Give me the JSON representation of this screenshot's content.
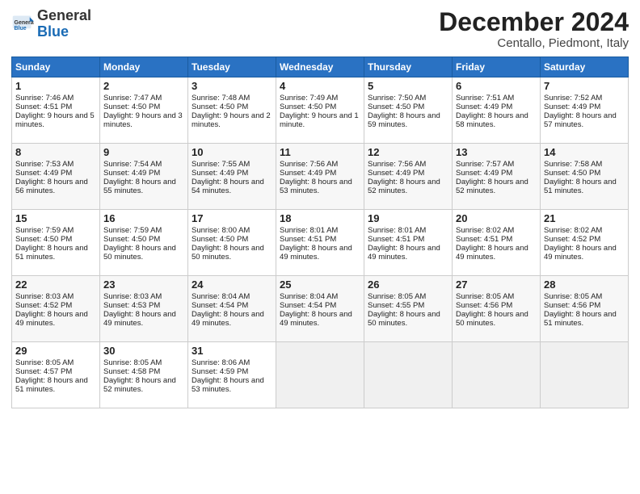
{
  "header": {
    "logo_general": "General",
    "logo_blue": "Blue",
    "month_title": "December 2024",
    "location": "Centallo, Piedmont, Italy"
  },
  "days_of_week": [
    "Sunday",
    "Monday",
    "Tuesday",
    "Wednesday",
    "Thursday",
    "Friday",
    "Saturday"
  ],
  "weeks": [
    [
      {
        "day": 1,
        "sunrise": "Sunrise: 7:46 AM",
        "sunset": "Sunset: 4:51 PM",
        "daylight": "Daylight: 9 hours and 5 minutes."
      },
      {
        "day": 2,
        "sunrise": "Sunrise: 7:47 AM",
        "sunset": "Sunset: 4:50 PM",
        "daylight": "Daylight: 9 hours and 3 minutes."
      },
      {
        "day": 3,
        "sunrise": "Sunrise: 7:48 AM",
        "sunset": "Sunset: 4:50 PM",
        "daylight": "Daylight: 9 hours and 2 minutes."
      },
      {
        "day": 4,
        "sunrise": "Sunrise: 7:49 AM",
        "sunset": "Sunset: 4:50 PM",
        "daylight": "Daylight: 9 hours and 1 minute."
      },
      {
        "day": 5,
        "sunrise": "Sunrise: 7:50 AM",
        "sunset": "Sunset: 4:50 PM",
        "daylight": "Daylight: 8 hours and 59 minutes."
      },
      {
        "day": 6,
        "sunrise": "Sunrise: 7:51 AM",
        "sunset": "Sunset: 4:49 PM",
        "daylight": "Daylight: 8 hours and 58 minutes."
      },
      {
        "day": 7,
        "sunrise": "Sunrise: 7:52 AM",
        "sunset": "Sunset: 4:49 PM",
        "daylight": "Daylight: 8 hours and 57 minutes."
      }
    ],
    [
      {
        "day": 8,
        "sunrise": "Sunrise: 7:53 AM",
        "sunset": "Sunset: 4:49 PM",
        "daylight": "Daylight: 8 hours and 56 minutes."
      },
      {
        "day": 9,
        "sunrise": "Sunrise: 7:54 AM",
        "sunset": "Sunset: 4:49 PM",
        "daylight": "Daylight: 8 hours and 55 minutes."
      },
      {
        "day": 10,
        "sunrise": "Sunrise: 7:55 AM",
        "sunset": "Sunset: 4:49 PM",
        "daylight": "Daylight: 8 hours and 54 minutes."
      },
      {
        "day": 11,
        "sunrise": "Sunrise: 7:56 AM",
        "sunset": "Sunset: 4:49 PM",
        "daylight": "Daylight: 8 hours and 53 minutes."
      },
      {
        "day": 12,
        "sunrise": "Sunrise: 7:56 AM",
        "sunset": "Sunset: 4:49 PM",
        "daylight": "Daylight: 8 hours and 52 minutes."
      },
      {
        "day": 13,
        "sunrise": "Sunrise: 7:57 AM",
        "sunset": "Sunset: 4:49 PM",
        "daylight": "Daylight: 8 hours and 52 minutes."
      },
      {
        "day": 14,
        "sunrise": "Sunrise: 7:58 AM",
        "sunset": "Sunset: 4:50 PM",
        "daylight": "Daylight: 8 hours and 51 minutes."
      }
    ],
    [
      {
        "day": 15,
        "sunrise": "Sunrise: 7:59 AM",
        "sunset": "Sunset: 4:50 PM",
        "daylight": "Daylight: 8 hours and 51 minutes."
      },
      {
        "day": 16,
        "sunrise": "Sunrise: 7:59 AM",
        "sunset": "Sunset: 4:50 PM",
        "daylight": "Daylight: 8 hours and 50 minutes."
      },
      {
        "day": 17,
        "sunrise": "Sunrise: 8:00 AM",
        "sunset": "Sunset: 4:50 PM",
        "daylight": "Daylight: 8 hours and 50 minutes."
      },
      {
        "day": 18,
        "sunrise": "Sunrise: 8:01 AM",
        "sunset": "Sunset: 4:51 PM",
        "daylight": "Daylight: 8 hours and 49 minutes."
      },
      {
        "day": 19,
        "sunrise": "Sunrise: 8:01 AM",
        "sunset": "Sunset: 4:51 PM",
        "daylight": "Daylight: 8 hours and 49 minutes."
      },
      {
        "day": 20,
        "sunrise": "Sunrise: 8:02 AM",
        "sunset": "Sunset: 4:51 PM",
        "daylight": "Daylight: 8 hours and 49 minutes."
      },
      {
        "day": 21,
        "sunrise": "Sunrise: 8:02 AM",
        "sunset": "Sunset: 4:52 PM",
        "daylight": "Daylight: 8 hours and 49 minutes."
      }
    ],
    [
      {
        "day": 22,
        "sunrise": "Sunrise: 8:03 AM",
        "sunset": "Sunset: 4:52 PM",
        "daylight": "Daylight: 8 hours and 49 minutes."
      },
      {
        "day": 23,
        "sunrise": "Sunrise: 8:03 AM",
        "sunset": "Sunset: 4:53 PM",
        "daylight": "Daylight: 8 hours and 49 minutes."
      },
      {
        "day": 24,
        "sunrise": "Sunrise: 8:04 AM",
        "sunset": "Sunset: 4:54 PM",
        "daylight": "Daylight: 8 hours and 49 minutes."
      },
      {
        "day": 25,
        "sunrise": "Sunrise: 8:04 AM",
        "sunset": "Sunset: 4:54 PM",
        "daylight": "Daylight: 8 hours and 49 minutes."
      },
      {
        "day": 26,
        "sunrise": "Sunrise: 8:05 AM",
        "sunset": "Sunset: 4:55 PM",
        "daylight": "Daylight: 8 hours and 50 minutes."
      },
      {
        "day": 27,
        "sunrise": "Sunrise: 8:05 AM",
        "sunset": "Sunset: 4:56 PM",
        "daylight": "Daylight: 8 hours and 50 minutes."
      },
      {
        "day": 28,
        "sunrise": "Sunrise: 8:05 AM",
        "sunset": "Sunset: 4:56 PM",
        "daylight": "Daylight: 8 hours and 51 minutes."
      }
    ],
    [
      {
        "day": 29,
        "sunrise": "Sunrise: 8:05 AM",
        "sunset": "Sunset: 4:57 PM",
        "daylight": "Daylight: 8 hours and 51 minutes."
      },
      {
        "day": 30,
        "sunrise": "Sunrise: 8:05 AM",
        "sunset": "Sunset: 4:58 PM",
        "daylight": "Daylight: 8 hours and 52 minutes."
      },
      {
        "day": 31,
        "sunrise": "Sunrise: 8:06 AM",
        "sunset": "Sunset: 4:59 PM",
        "daylight": "Daylight: 8 hours and 53 minutes."
      },
      null,
      null,
      null,
      null
    ]
  ]
}
